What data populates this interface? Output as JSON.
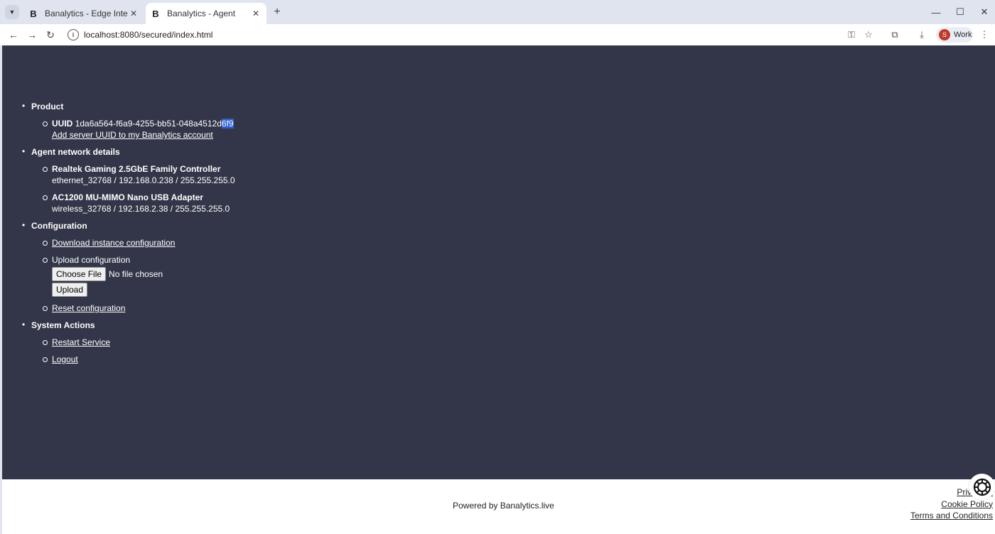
{
  "browser": {
    "tabs": [
      {
        "title": "Banalytics - Edge Intelligence f",
        "favicon": "B",
        "active": false
      },
      {
        "title": "Banalytics - Agent",
        "favicon": "B",
        "active": true
      }
    ],
    "url": "localhost:8080/secured/index.html",
    "profile_label": "Work",
    "profile_initial": "S"
  },
  "product": {
    "heading": "Product",
    "uuid_label": "UUID",
    "uuid_value_main": "1da6a564-f6a9-4255-bb51-048a4512d",
    "uuid_value_selected": "6f9",
    "add_link": "Add server UUID to my Banalytics account"
  },
  "network": {
    "heading": "Agent network details",
    "adapters": [
      {
        "name": "Realtek Gaming 2.5GbE Family Controller",
        "details": "ethernet_32768 / 192.168.0.238 / 255.255.255.0"
      },
      {
        "name": "AC1200 MU-MIMO Nano USB Adapter",
        "details": "wireless_32768 / 192.168.2.38 / 255.255.255.0"
      }
    ]
  },
  "configuration": {
    "heading": "Configuration",
    "download_link": "Download instance configuration",
    "upload_label": "Upload configuration",
    "choose_file": "Choose File",
    "no_file": "No file chosen",
    "upload_button": "Upload",
    "reset_link": "Reset configuration"
  },
  "system": {
    "heading": "System Actions",
    "restart_link": "Restart Service",
    "logout_link": "Logout"
  },
  "footer": {
    "powered": "Powered by Banalytics.live",
    "privacy": "Privacy P",
    "cookie": "Cookie Policy",
    "terms": "Terms and Conditions"
  },
  "colors": {
    "page_bg": "#333649",
    "selection": "#2f5fcf"
  }
}
